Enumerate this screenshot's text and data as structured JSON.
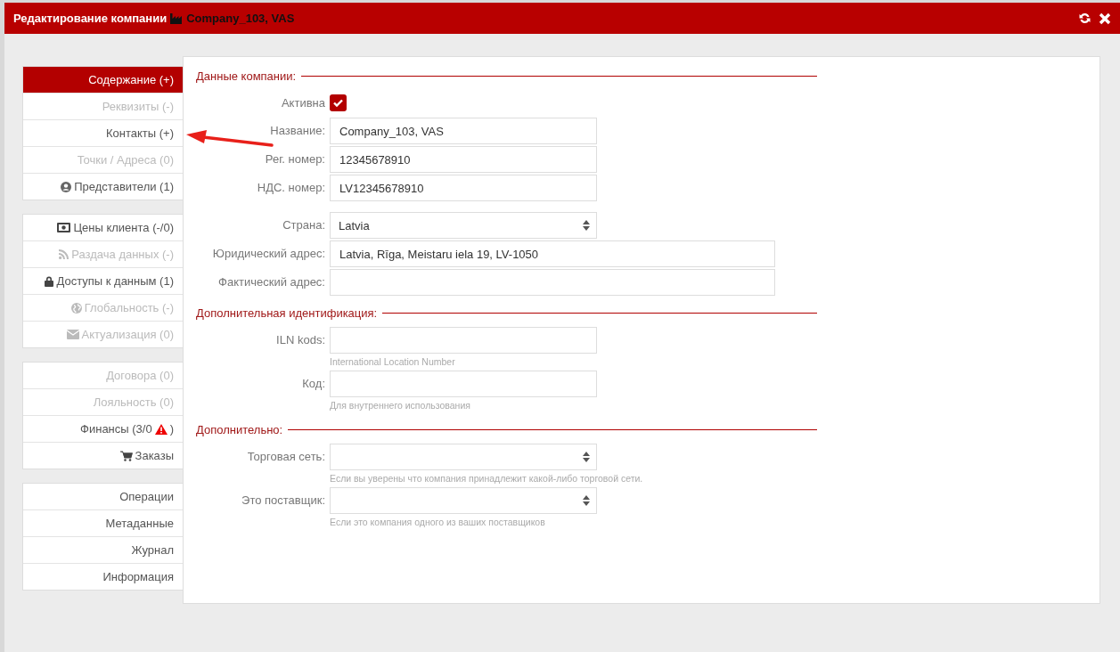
{
  "window": {
    "title": "Редактирование компании",
    "subject": "Company_103, VAS"
  },
  "sidebar": {
    "groups": [
      [
        {
          "kind": "plain",
          "label": "Содержание (+)",
          "selected": true,
          "disabled": false
        },
        {
          "kind": "plain",
          "label": "Реквизиты (-)",
          "selected": false,
          "disabled": true
        },
        {
          "kind": "plain",
          "label": "Контакты (+)",
          "selected": false,
          "disabled": false
        },
        {
          "kind": "plain",
          "label": "Точки / Адреса (0)",
          "selected": false,
          "disabled": true
        },
        {
          "kind": "person",
          "label": "Представители (1)",
          "selected": false,
          "disabled": false
        }
      ],
      [
        {
          "kind": "money",
          "label": "Цены клиента (-/0)",
          "selected": false,
          "disabled": false
        },
        {
          "kind": "feed",
          "label": "Раздача данных (-)",
          "selected": false,
          "disabled": true
        },
        {
          "kind": "lock",
          "label": "Доступы к данным (1)",
          "selected": false,
          "disabled": false
        },
        {
          "kind": "globe",
          "label": "Глобальность (-)",
          "selected": false,
          "disabled": true
        },
        {
          "kind": "mail",
          "label": "Актуализация (0)",
          "selected": false,
          "disabled": true
        }
      ],
      [
        {
          "kind": "plain",
          "label": "Договора (0)",
          "selected": false,
          "disabled": true
        },
        {
          "kind": "plain",
          "label": "Лояльность (0)",
          "selected": false,
          "disabled": true
        },
        {
          "kind": "plain",
          "label": "Финансы (3/0",
          "warning": true,
          "suffix": ")",
          "selected": false,
          "disabled": false
        },
        {
          "kind": "cart",
          "label": "Заказы",
          "selected": false,
          "disabled": false
        }
      ],
      [
        {
          "kind": "plain",
          "label": "Операции",
          "selected": false,
          "disabled": false
        },
        {
          "kind": "plain",
          "label": "Метаданные",
          "selected": false,
          "disabled": false
        },
        {
          "kind": "plain",
          "label": "Журнал",
          "selected": false,
          "disabled": false
        },
        {
          "kind": "plain",
          "label": "Информация",
          "selected": false,
          "disabled": false
        }
      ]
    ]
  },
  "sections": [
    {
      "title": "Данные компании:",
      "groups": [
        [
          {
            "kind": "checkbox",
            "label": "Активна",
            "checked": true
          },
          {
            "kind": "text",
            "label": "Название:",
            "value": "Company_103, VAS"
          },
          {
            "kind": "text",
            "label": "Рег. номер:",
            "value": "12345678910"
          },
          {
            "kind": "text",
            "label": "НДС. номер:",
            "value": "LV12345678910"
          }
        ],
        [
          {
            "kind": "select",
            "label": "Страна:",
            "value": "Latvia"
          },
          {
            "kind": "wide",
            "label": "Юридический адрес:",
            "value": "Latvia, Rīga, Meistaru iela 19, LV-1050"
          },
          {
            "kind": "wide",
            "label": "Фактический адрес:"
          }
        ]
      ]
    },
    {
      "title": "Дополнительная идентификация:",
      "groups": [
        [
          {
            "kind": "text",
            "label": "ILN kods:",
            "hint": "International Location Number"
          },
          {
            "kind": "text",
            "label": "Код:",
            "hint": "Для внутреннего использования"
          }
        ]
      ]
    },
    {
      "title": "Дополнительно:",
      "groups": [
        [
          {
            "kind": "select",
            "label": "Торговая сеть:",
            "hint": "Если вы уверены что компания принадлежит какой-либо торговой сети."
          },
          {
            "kind": "select",
            "label": "Это поставщик:",
            "hint": "Если это компания одного из ваших поставщиков"
          }
        ]
      ]
    }
  ]
}
